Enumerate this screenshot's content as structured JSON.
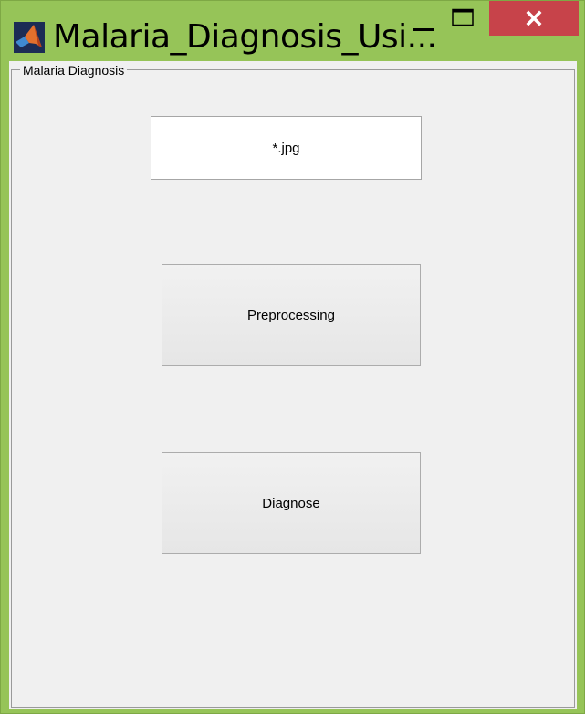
{
  "window": {
    "title": "Malaria_Diagnosis_Usi...",
    "frame_color": "#96c458",
    "close_color": "#c7434a",
    "icons": {
      "app": "matlab-logo-icon",
      "minimize": "minimize-icon",
      "maximize": "maximize-icon",
      "close": "close-icon"
    }
  },
  "panel": {
    "title": "Malaria Diagnosis"
  },
  "file_input": {
    "value": "*.jpg"
  },
  "buttons": {
    "preprocessing": "Preprocessing",
    "diagnose": "Diagnose"
  }
}
